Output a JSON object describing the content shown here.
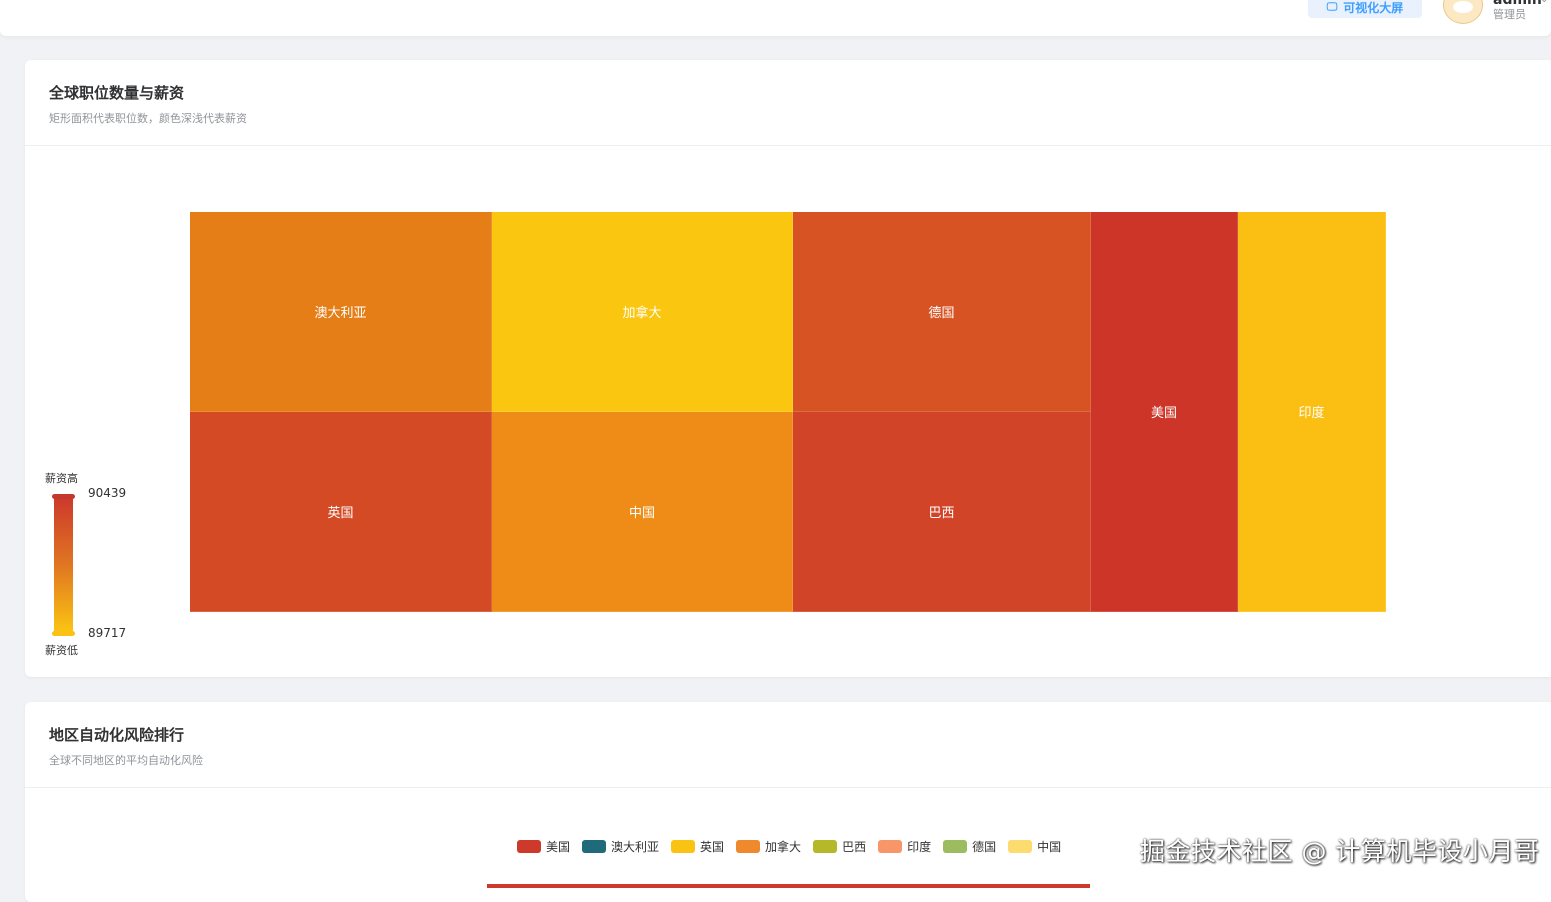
{
  "topbar": {
    "screen_button": "可视化大屏",
    "screen_icon": "monitor-icon",
    "user_name": "admin",
    "user_role": "管理员"
  },
  "card1": {
    "title": "全球职位数量与薪资",
    "subtitle": "矩形面积代表职位数，颜色深浅代表薪资",
    "visual_map": {
      "high_label": "薪资高",
      "low_label": "薪资低",
      "max": "90439",
      "min": "89717"
    }
  },
  "card2": {
    "title": "地区自动化风险排行",
    "subtitle": "全球不同地区的平均自动化风险"
  },
  "watermark": "掘金技术社区 @ 计算机毕设小月哥",
  "chart_data": [
    {
      "type": "treemap",
      "title": "全球职位数量与薪资",
      "subtitle": "矩形面积代表职位数，颜色深浅代表薪资",
      "visual_map": {
        "min": 89717,
        "max": 90439,
        "min_label": "薪资低",
        "max_label": "薪资高",
        "colors": [
          "#fac313",
          "#e07622",
          "#cd3a2b"
        ]
      },
      "items": [
        {
          "label": "澳大利亚",
          "color": "#e57e16"
        },
        {
          "label": "英国",
          "color": "#d44a24"
        },
        {
          "label": "加拿大",
          "color": "#fbc610"
        },
        {
          "label": "中国",
          "color": "#ee8c17"
        },
        {
          "label": "德国",
          "color": "#d85323"
        },
        {
          "label": "巴西",
          "color": "#d24428"
        },
        {
          "label": "美国",
          "color": "#cd3529"
        },
        {
          "label": "印度",
          "color": "#fbbf14"
        }
      ]
    },
    {
      "type": "bar",
      "title": "地区自动化风险排行",
      "subtitle": "全球不同地区的平均自动化风险",
      "legend": [
        {
          "name": "美国",
          "color": "#cd3a2b"
        },
        {
          "name": "澳大利亚",
          "color": "#1f6b7a"
        },
        {
          "name": "英国",
          "color": "#fac313"
        },
        {
          "name": "加拿大",
          "color": "#ee8a2d"
        },
        {
          "name": "巴西",
          "color": "#b4b829"
        },
        {
          "name": "印度",
          "color": "#f8966a"
        },
        {
          "name": "德国",
          "color": "#9bbd5f"
        },
        {
          "name": "中国",
          "color": "#fddc6f"
        }
      ]
    }
  ]
}
